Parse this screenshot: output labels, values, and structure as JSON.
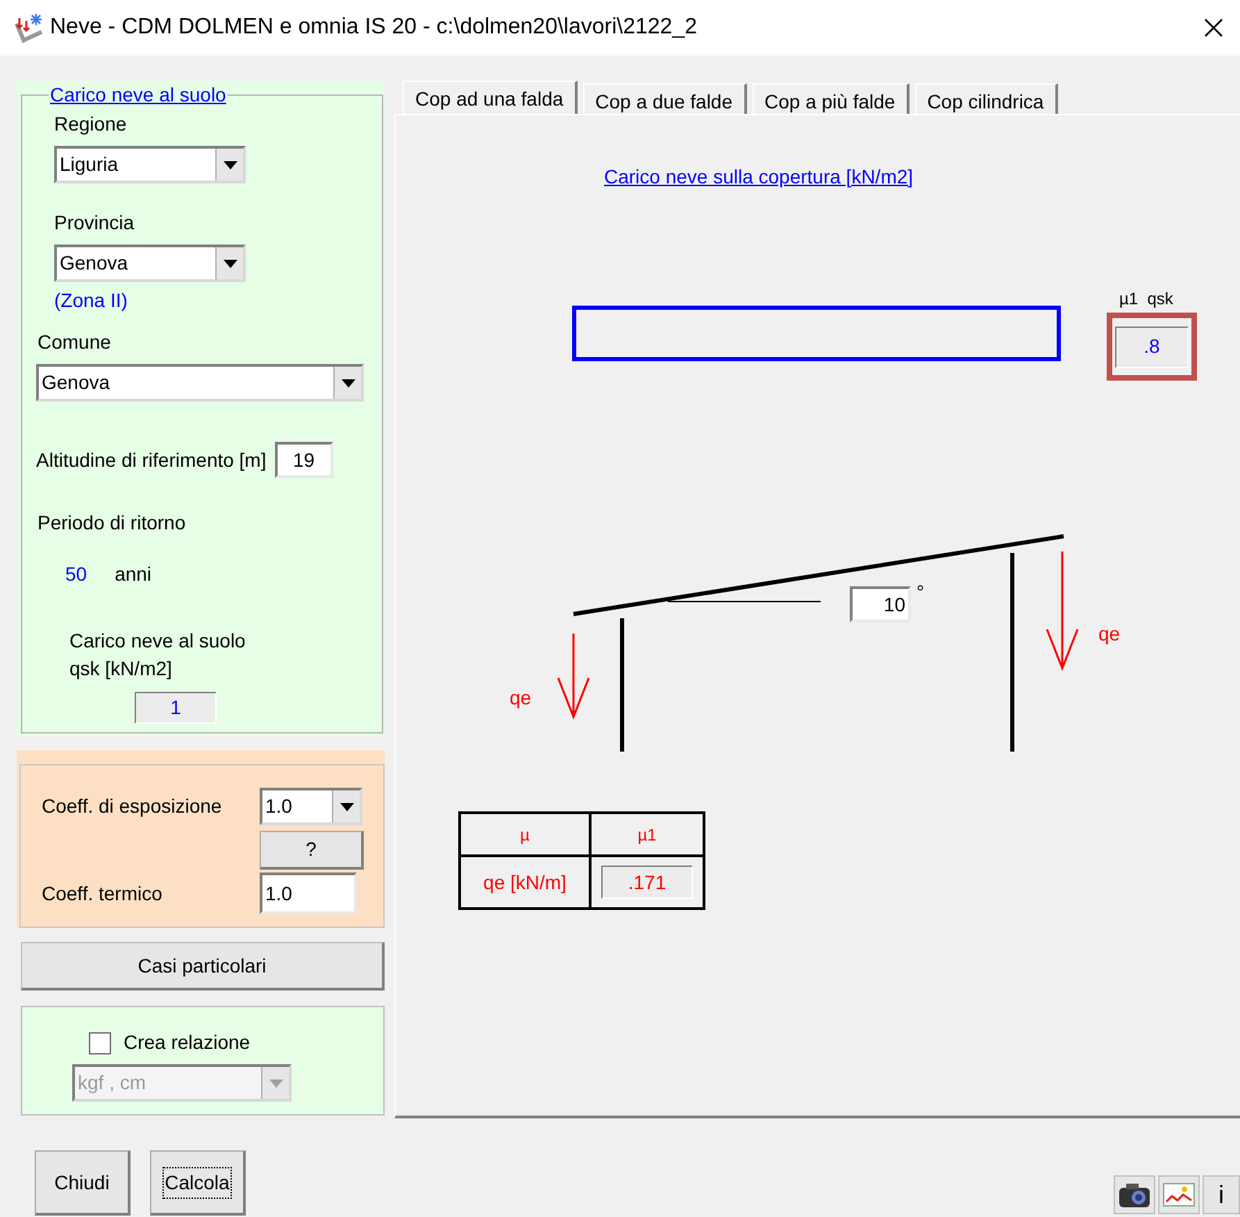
{
  "window": {
    "title": "Neve - CDM DOLMEN e omnia IS 20 - c:\\dolmen20\\lavori\\2122_2"
  },
  "ground_snow": {
    "title": "Carico neve al suolo",
    "region": {
      "label": "Regione",
      "value": "Liguria"
    },
    "province": {
      "label": "Provincia",
      "value": "Genova"
    },
    "zone": "(Zona II)",
    "municipality": {
      "label": "Comune",
      "value": "Genova"
    },
    "altitude": {
      "label": "Altitudine di riferimento [m]",
      "value": "19"
    },
    "return_period": {
      "label": "Periodo di ritorno",
      "value": "50",
      "unit": "anni"
    },
    "qsk": {
      "label": "Carico neve al suolo qsk [kN/m2]",
      "value": "1"
    }
  },
  "coefficients": {
    "exposure": {
      "label": "Coeff. di esposizione",
      "value": "1.0"
    },
    "help_button": "?",
    "thermal": {
      "label": "Coeff. termico",
      "value": "1.0"
    }
  },
  "special_cases_button": "Casi particolari",
  "report": {
    "label": "Crea relazione",
    "checked": false,
    "units": "kgf , cm",
    "disabled": true
  },
  "buttons": [
    {
      "label": "Chiudi",
      "focused": false
    },
    {
      "label": "Calcola",
      "focused": true
    }
  ],
  "tabs": [
    {
      "label": "Cop ad una falda",
      "selected": true
    },
    {
      "label": "Cop a due falde",
      "selected": false
    },
    {
      "label": "Cop a più falde",
      "selected": false
    },
    {
      "label": "Cop cilindrica",
      "selected": false
    }
  ],
  "roof": {
    "title": "Carico neve sulla copertura [kN/m2]",
    "mu1_qsk_label": "µ1  qsk",
    "mu1_qsk_value": ".8",
    "angle": "10",
    "degree": "°",
    "load_left": "qe",
    "load_right": "qe",
    "table": {
      "headers": [
        "µ",
        "µ1"
      ],
      "row_label": "qe [kN/m]",
      "value": ".171"
    }
  },
  "toolbar": {
    "info": "i"
  }
}
